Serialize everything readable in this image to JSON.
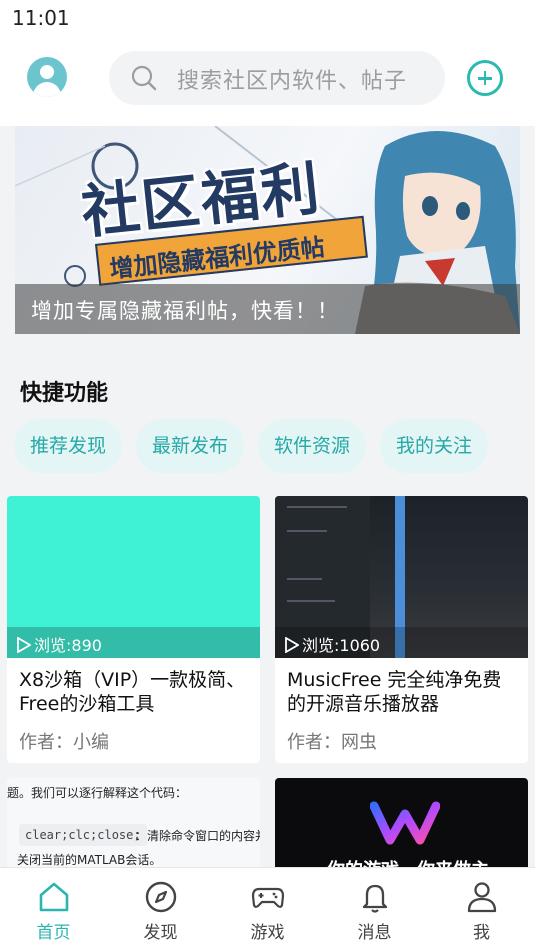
{
  "status_bar": {
    "time": "11:01"
  },
  "header": {
    "search_placeholder": "搜索社区内软件、帖子",
    "avatar_icon": "user-avatar-icon",
    "add_icon": "plus-circle-icon",
    "accent_color": "#2bbab0"
  },
  "banner": {
    "title": "社区福利",
    "subtitle": "增加隐藏福利优质帖",
    "caption": "增加专属隐藏福利帖，快看！！"
  },
  "quick": {
    "title": "快捷功能",
    "chips": [
      "推荐发现",
      "最新发布",
      "软件资源",
      "我的关注"
    ]
  },
  "cards": [
    {
      "views": "浏览:890",
      "title": "X8沙箱（VIP）一款极简、Free的沙箱工具",
      "author": "作者：小编"
    },
    {
      "views": "浏览:1060",
      "title": "MusicFree 完全纯净免费的开源音乐播放器",
      "author": "作者：网虫"
    },
    {
      "preview_lines": [
        "题。我们可以逐行解释这个代码：",
        "clear;clc;close;",
        "：清除命令窗口的内容并",
        "关闭当前的MATLAB会话。"
      ]
    },
    {
      "preview_text": "你的游戏，你来做主"
    }
  ],
  "tabbar": {
    "items": [
      {
        "label": "首页",
        "icon": "home-icon",
        "active": true
      },
      {
        "label": "发现",
        "icon": "compass-icon",
        "active": false
      },
      {
        "label": "游戏",
        "icon": "gamepad-icon",
        "active": false
      },
      {
        "label": "消息",
        "icon": "bell-icon",
        "active": false
      },
      {
        "label": "我",
        "icon": "person-icon",
        "active": false
      }
    ]
  }
}
